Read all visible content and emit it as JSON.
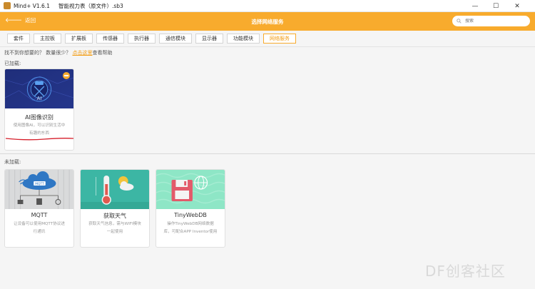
{
  "window": {
    "app_title": "Mind+ V1.6.1",
    "doc_title": "智能视力表（原文件）.sb3",
    "controls": {
      "minimize": "—",
      "maximize": "☐",
      "close": "✕"
    }
  },
  "header": {
    "back_label": "返回",
    "title": "选择网络服务",
    "search_placeholder": "搜索"
  },
  "tabs": [
    {
      "label": "套件"
    },
    {
      "label": "主控板"
    },
    {
      "label": "扩展板"
    },
    {
      "label": "传感器"
    },
    {
      "label": "执行器"
    },
    {
      "label": "通信模块"
    },
    {
      "label": "显示器"
    },
    {
      "label": "功能模块"
    },
    {
      "label": "网络服务",
      "active": true
    }
  ],
  "hint": {
    "prefix": "找不到你想要的？ 数量很少？",
    "link": "点击这里",
    "suffix": "查看帮助"
  },
  "loaded": {
    "label": "已加载:",
    "cards": [
      {
        "name": "AI图像识别",
        "desc": "使用图像AI，可以识别生活中有趣的东西",
        "icon_text": "AI"
      }
    ]
  },
  "unloaded": {
    "label": "未加载:",
    "cards": [
      {
        "name": "MQTT",
        "desc": "让设备可以使用MQTT协议进行通讯",
        "icon_text": "MQTT"
      },
      {
        "name": "获取天气",
        "desc": "获取天气信息，需与WIFI模块一起使用"
      },
      {
        "name": "TinyWebDB",
        "desc": "操作TinyWebDB网络数据库，可配合APP Inventor使用"
      }
    ]
  },
  "watermark": "DF创客社区",
  "colors": {
    "accent": "#f8ab2d",
    "accent_text": "#f29b10",
    "annotation": "#d61f2b"
  }
}
